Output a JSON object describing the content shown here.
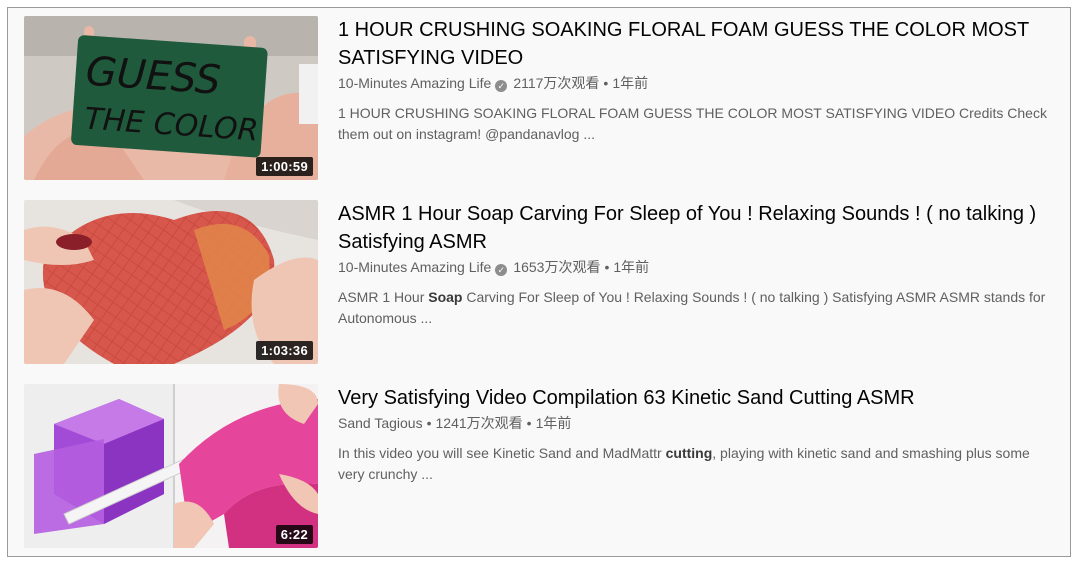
{
  "results": [
    {
      "title": "1 HOUR CRUSHING SOAKING FLORAL FOAM GUESS THE COLOR MOST SATISFYING VIDEO",
      "channel": "10-Minutes Amazing Life",
      "verified": true,
      "views": "2117万次观看",
      "age": "1年前",
      "duration": "1:00:59",
      "desc_before": "1 HOUR CRUSHING SOAKING FLORAL FOAM GUESS THE COLOR MOST SATISFYING VIDEO Credits Check them out on instagram! @pandanavlog ...",
      "desc_bold": "",
      "desc_after": "",
      "thumb_text_1": "GUESS",
      "thumb_text_2": "THE COLOR"
    },
    {
      "title": "ASMR 1 Hour Soap Carving For Sleep of You ! Relaxing Sounds ! ( no talking ) Satisfying ASMR",
      "channel": "10-Minutes Amazing Life",
      "verified": true,
      "views": "1653万次观看",
      "age": "1年前",
      "duration": "1:03:36",
      "desc_before": "ASMR 1 Hour ",
      "desc_bold": "Soap",
      "desc_after": " Carving For Sleep of You ! Relaxing Sounds ! ( no talking ) Satisfying ASMR ASMR stands for Autonomous ..."
    },
    {
      "title": "Very Satisfying Video Compilation 63 Kinetic Sand Cutting ASMR",
      "channel": "Sand Tagious",
      "verified": false,
      "views": "1241万次观看",
      "age": "1年前",
      "duration": "6:22",
      "desc_before": "In this video you will see Kinetic Sand and MadMattr ",
      "desc_bold": "cutting",
      "desc_after": ", playing with kinetic sand and smashing plus some very crunchy ..."
    }
  ],
  "separator": "•",
  "icons": {
    "verified": "verified-check-icon"
  }
}
